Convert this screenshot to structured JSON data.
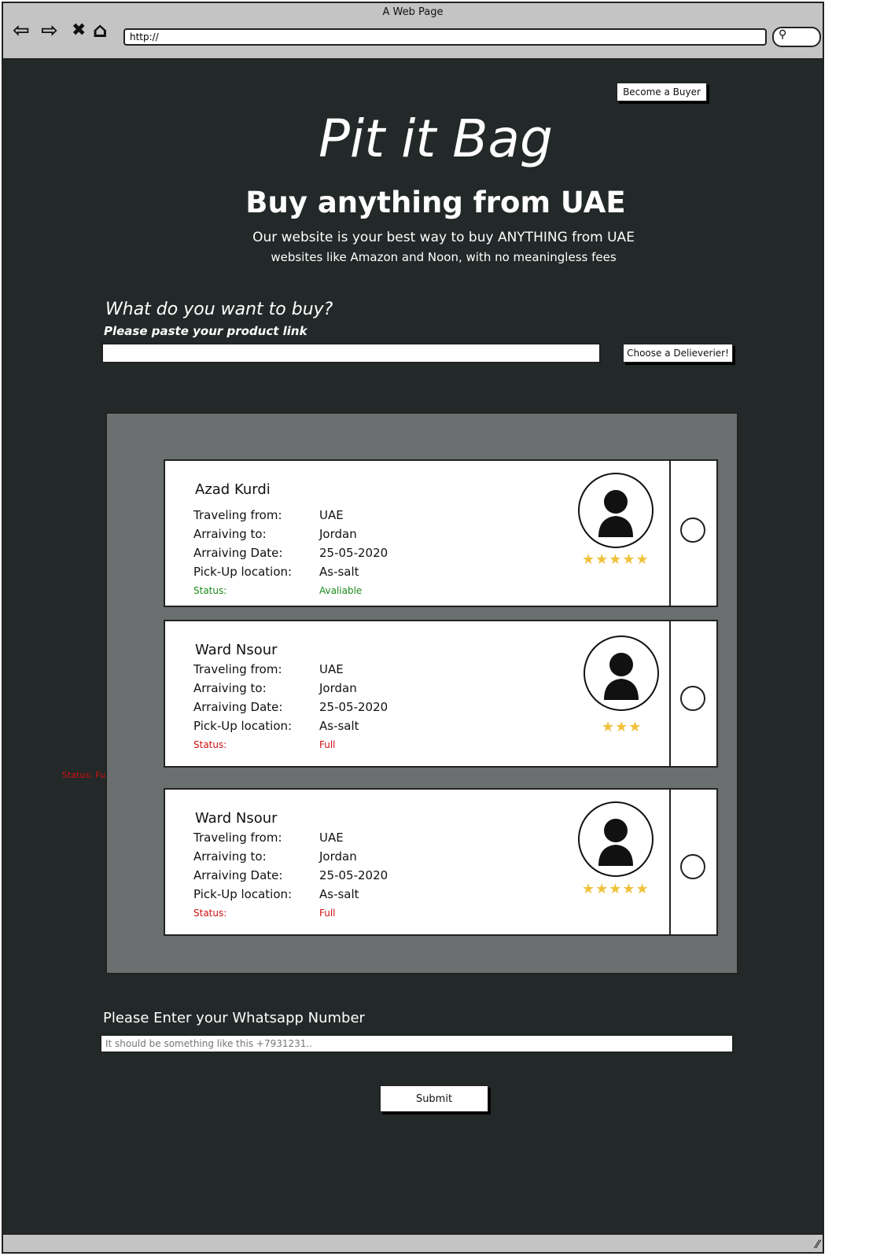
{
  "browser": {
    "window_title": "A Web Page",
    "url": "http://"
  },
  "header": {
    "become_buyer": "Become a Buyer",
    "brand": "Pit it Bag",
    "headline": "Buy anything from UAE",
    "tagline_1": "Our website is your best way to buy ANYTHING from UAE",
    "tagline_2": "websites like Amazon and Noon, with no meaningless fees"
  },
  "search": {
    "question": "What do you want to buy?",
    "hint": "Please paste your product link",
    "link_value": "",
    "choose_button": "Choose a Delieverier!"
  },
  "labels": {
    "traveling_from": "Traveling from:",
    "arriving_to": "Arraiving to:",
    "arriving_date": "Arraiving Date:",
    "pickup": "Pick-Up location:",
    "status": "Status:"
  },
  "deliverers": [
    {
      "name": "Azad Kurdi",
      "from": "UAE",
      "to": "Jordan",
      "date": "25-05-2020",
      "pickup": "As-salt",
      "status": "Avaliable",
      "status_color": "#1a8a1a",
      "stars": "★★★★★"
    },
    {
      "name": "Ward Nsour",
      "from": "UAE",
      "to": "Jordan",
      "date": "25-05-2020",
      "pickup": "As-salt",
      "status": "Full",
      "status_color": "#d01010",
      "stars": "★★★"
    },
    {
      "name": "Ward Nsour",
      "from": "UAE",
      "to": "Jordan",
      "date": "25-05-2020",
      "pickup": "As-salt",
      "status": "Full",
      "status_color": "#d01010",
      "stars": "★★★★★"
    }
  ],
  "floating_note": "Status: Full",
  "whatsapp": {
    "label": "Please Enter your Whatsapp Number",
    "placeholder": "It should be something like this +7931231..",
    "submit": "Submit"
  },
  "icons": {
    "back": "back-arrow-icon",
    "forward": "forward-arrow-icon",
    "stop": "close-icon",
    "home": "home-icon",
    "search": "search-icon",
    "avatar": "user-icon",
    "resize": "resize-grip-icon"
  }
}
